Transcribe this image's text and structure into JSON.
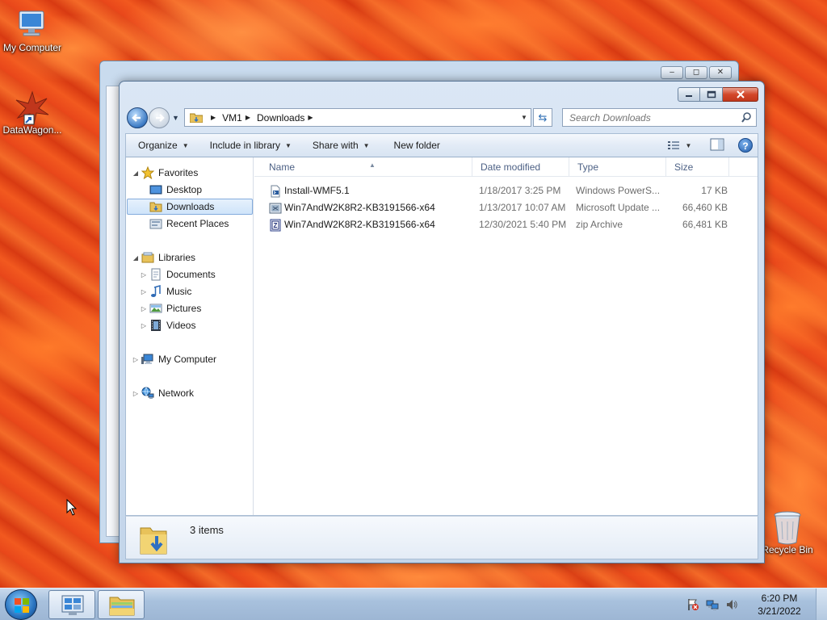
{
  "desktop": {
    "icons": [
      {
        "label": "My Computer",
        "icon": "computer-icon"
      },
      {
        "label": "DataWagon...",
        "icon": "shortcut-icon"
      },
      {
        "label": "Recycle Bin",
        "icon": "recycle-bin-icon"
      }
    ]
  },
  "window": {
    "address": {
      "crumbs": [
        "VM1",
        "Downloads"
      ]
    },
    "search": {
      "placeholder": "Search Downloads"
    },
    "commands": {
      "organize": "Organize",
      "include_in_library": "Include in library",
      "share_with": "Share with",
      "new_folder": "New folder"
    },
    "nav": {
      "favorites": "Favorites",
      "desktop": "Desktop",
      "downloads": "Downloads",
      "recent_places": "Recent Places",
      "libraries": "Libraries",
      "documents": "Documents",
      "music": "Music",
      "pictures": "Pictures",
      "videos": "Videos",
      "my_computer": "My Computer",
      "network": "Network"
    },
    "columns": {
      "name": "Name",
      "date_modified": "Date modified",
      "type": "Type",
      "size": "Size"
    },
    "files": [
      {
        "name": "Install-WMF5.1",
        "date": "1/18/2017 3:25 PM",
        "type": "Windows PowerS...",
        "size": "17 KB",
        "icon": "powershell-script-icon"
      },
      {
        "name": "Win7AndW2K8R2-KB3191566-x64",
        "date": "1/13/2017 10:07 AM",
        "type": "Microsoft Update ...",
        "size": "66,460 KB",
        "icon": "update-package-icon"
      },
      {
        "name": "Win7AndW2K8R2-KB3191566-x64",
        "date": "12/30/2021 5:40 PM",
        "type": "zip Archive",
        "size": "66,481 KB",
        "icon": "zip-archive-icon"
      }
    ],
    "status": {
      "item_count": "3 items"
    }
  },
  "taskbar": {
    "clock_time": "6:20 PM",
    "clock_date": "3/21/2022"
  },
  "colors": {
    "selection_bg": "#cfe4fa",
    "selection_border": "#84acdd",
    "header_text": "#4d6185",
    "secondary_text": "#6d6d6d"
  }
}
